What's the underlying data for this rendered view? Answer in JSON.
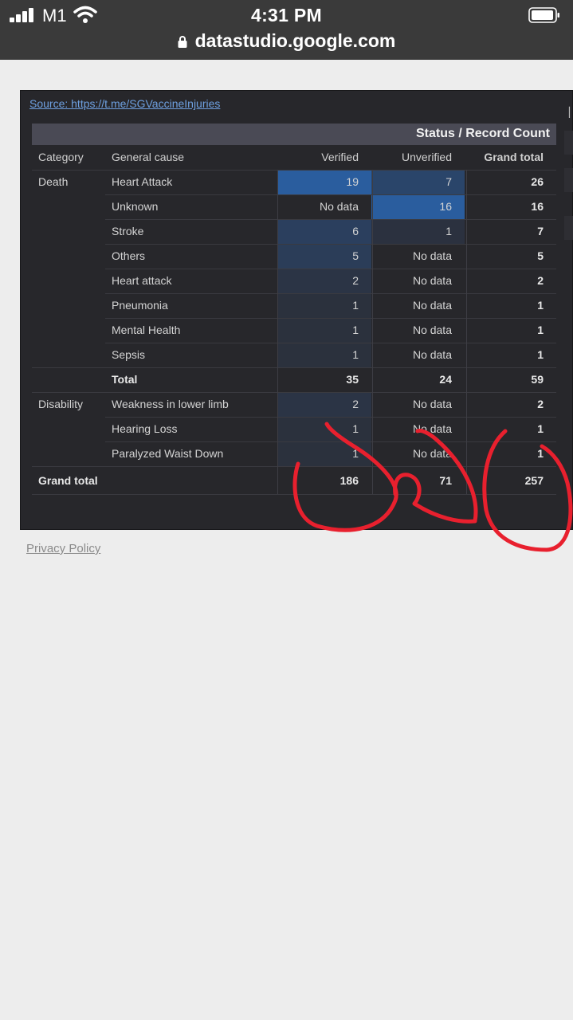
{
  "status_bar": {
    "carrier": "M1",
    "time": "4:31 PM"
  },
  "browser": {
    "url": "datastudio.google.com"
  },
  "report": {
    "source_link": "Source: https://t.me/SGVaccineInjuries",
    "table": {
      "pivot_header": "Status / Record Count",
      "columns": {
        "category": "Category",
        "general_cause": "General cause",
        "verified": "Verified",
        "unverified": "Unverified",
        "grand_total": "Grand total"
      },
      "rows": [
        {
          "category": "Death",
          "cause": "Heart Attack",
          "verified": "19",
          "unverified": "7",
          "total": "26"
        },
        {
          "category": "",
          "cause": "Unknown",
          "verified": "No data",
          "unverified": "16",
          "total": "16"
        },
        {
          "category": "",
          "cause": "Stroke",
          "verified": "6",
          "unverified": "1",
          "total": "7"
        },
        {
          "category": "",
          "cause": "Others",
          "verified": "5",
          "unverified": "No data",
          "total": "5"
        },
        {
          "category": "",
          "cause": "Heart attack",
          "verified": "2",
          "unverified": "No data",
          "total": "2"
        },
        {
          "category": "",
          "cause": "Pneumonia",
          "verified": "1",
          "unverified": "No data",
          "total": "1"
        },
        {
          "category": "",
          "cause": "Mental Health",
          "verified": "1",
          "unverified": "No data",
          "total": "1"
        },
        {
          "category": "",
          "cause": "Sepsis",
          "verified": "1",
          "unverified": "No data",
          "total": "1"
        },
        {
          "category": "",
          "cause": "Total",
          "verified": "35",
          "unverified": "24",
          "total": "59",
          "subtotal": true
        },
        {
          "category": "Disability",
          "cause": "Weakness in lower limb",
          "verified": "2",
          "unverified": "No data",
          "total": "2"
        },
        {
          "category": "",
          "cause": "Hearing Loss",
          "verified": "1",
          "unverified": "No data",
          "total": "1"
        },
        {
          "category": "",
          "cause": "Paralyzed Waist Down",
          "verified": "1",
          "unverified": "No data",
          "total": "1"
        }
      ],
      "grand_total_row": {
        "label": "Grand total",
        "verified": "186",
        "unverified": "71",
        "total": "257"
      }
    }
  },
  "footer": {
    "privacy_link": "Privacy Policy"
  },
  "colors": {
    "heat_max": "#2a5d9e",
    "heat_low": "#2f3a4f",
    "annotation": "#e8202e",
    "link": "#6ea0e0"
  }
}
